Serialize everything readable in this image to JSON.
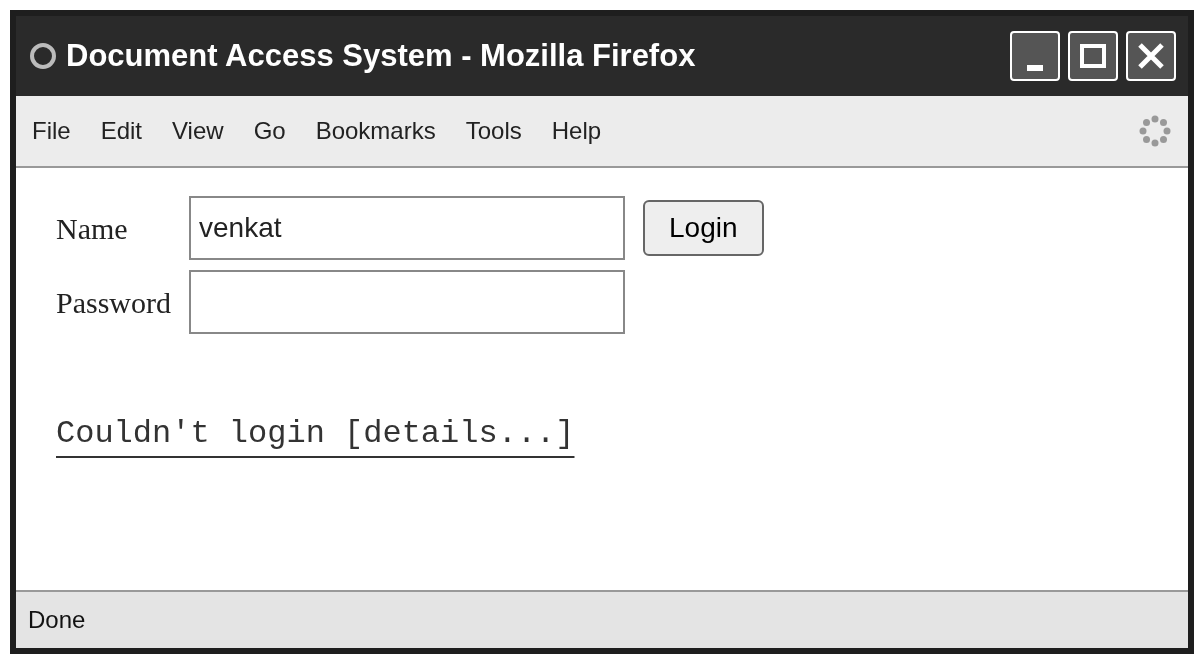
{
  "window": {
    "title": "Document Access System - Mozilla Firefox"
  },
  "menu": [
    {
      "label": "File"
    },
    {
      "label": "Edit"
    },
    {
      "label": "View"
    },
    {
      "label": "Go"
    },
    {
      "label": "Bookmarks"
    },
    {
      "label": "Tools"
    },
    {
      "label": "Help"
    }
  ],
  "form": {
    "fields": [
      {
        "label": "Name",
        "value": "venkat"
      },
      {
        "label": "Password"
      }
    ],
    "button": "Login"
  },
  "error_link": "Couldn't login [details...]",
  "status_bar": "Done"
}
